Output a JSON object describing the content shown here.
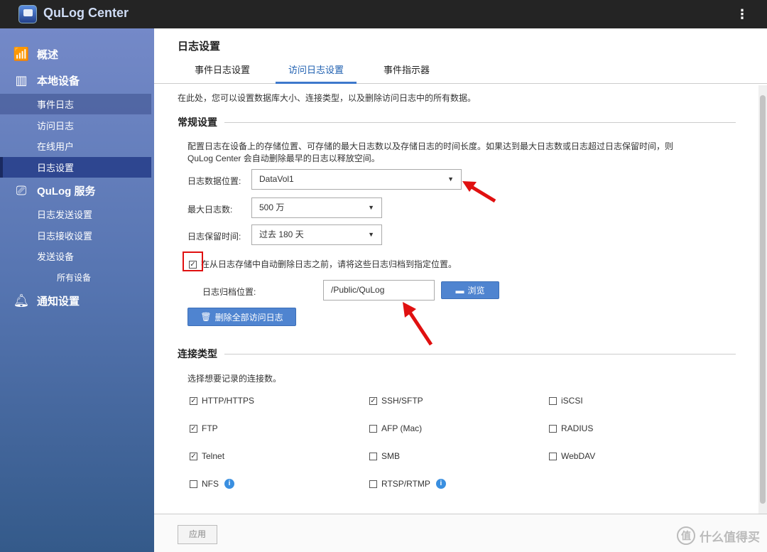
{
  "app": {
    "title": "QuLog Center"
  },
  "sidebar": {
    "overview": "概述",
    "local_device": "本地设备",
    "local_items": [
      "事件日志",
      "访问日志",
      "在线用户",
      "日志设置"
    ],
    "qulog_service": "QuLog 服务",
    "service_items": [
      "日志发送设置",
      "日志接收设置",
      "发送设备"
    ],
    "all_devices": "所有设备",
    "notification": "通知设置"
  },
  "page": {
    "title": "日志设置",
    "tabs": [
      "事件日志设置",
      "访问日志设置",
      "事件指示器"
    ],
    "intro": "在此处，您可以设置数据库大小、连接类型，以及删除访问日志中的所有数据。",
    "general": {
      "heading": "常规设置",
      "desc1": "配置日志在设备上的存储位置、可存储的最大日志数以及存储日志的时间长度。如果达到最大日志数或日志超过日志保留时间，则",
      "desc2": "QuLog Center 会自动删除最早的日志以释放空间。",
      "location_label": "日志数据位置:",
      "location_value": "DataVol1",
      "max_label": "最大日志数:",
      "max_value": "500 万",
      "retention_label": "日志保留时间:",
      "retention_value": "过去 180 天",
      "archive_checkbox": "在从日志存储中自动删除日志之前，请将这些日志归档到指定位置。",
      "archive_checked": true,
      "archive_label": "日志归档位置:",
      "archive_value": "/Public/QuLog",
      "browse": "浏览",
      "delete_all": "删除全部访问日志"
    },
    "connection": {
      "heading": "连接类型",
      "desc": "选择想要记录的连接数。",
      "items": [
        {
          "label": "HTTP/HTTPS",
          "checked": true
        },
        {
          "label": "SSH/SFTP",
          "checked": true
        },
        {
          "label": "iSCSI",
          "checked": false
        },
        {
          "label": "FTP",
          "checked": true
        },
        {
          "label": "AFP (Mac)",
          "checked": false
        },
        {
          "label": "RADIUS",
          "checked": false
        },
        {
          "label": "Telnet",
          "checked": true
        },
        {
          "label": "SMB",
          "checked": false
        },
        {
          "label": "WebDAV",
          "checked": false
        },
        {
          "label": "NFS",
          "checked": false,
          "info": true
        },
        {
          "label": "RTSP/RTMP",
          "checked": false,
          "info": true
        }
      ]
    },
    "apply": "应用"
  },
  "watermark": "什么值得买",
  "colors": {
    "accent": "#4f84d0",
    "annotation": "#e01010",
    "topbar": "#242424"
  }
}
